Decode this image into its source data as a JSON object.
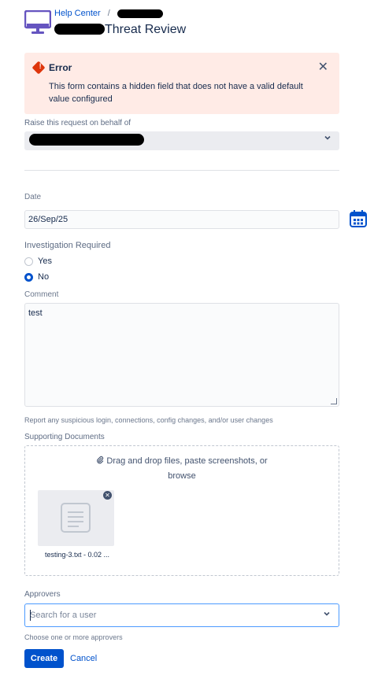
{
  "header": {
    "breadcrumb_root": "Help Center",
    "breadcrumb_sep": "/",
    "title_suffix": "Threat Review"
  },
  "error": {
    "title": "Error",
    "message": "This form contains a hidden field that does not have a valid default value configured",
    "close_symbol": "✕"
  },
  "behalf": {
    "label": "Raise this request on behalf of"
  },
  "date": {
    "label": "Date",
    "value": "26/Sep/25"
  },
  "investigation": {
    "label": "Investigation Required",
    "options": [
      {
        "label": "Yes",
        "checked": false
      },
      {
        "label": "No",
        "checked": true
      }
    ]
  },
  "comment": {
    "label": "Comment",
    "value": "test",
    "help": "Report any suspicious login, connections, config changes, and/or user changes"
  },
  "documents": {
    "label": "Supporting Documents",
    "drop_text": "Drag and drop files, paste screenshots, or",
    "browse_text": "browse",
    "file_name": "testing-3.txt - 0.02 ..."
  },
  "approvers": {
    "label": "Approvers",
    "placeholder": "Search for a user",
    "help": "Choose one or more approvers"
  },
  "actions": {
    "create": "Create",
    "cancel": "Cancel"
  },
  "colors": {
    "primary": "#0052cc",
    "error_bg": "#ffebe6",
    "error_icon": "#de350b",
    "logo": "#6554c0"
  }
}
